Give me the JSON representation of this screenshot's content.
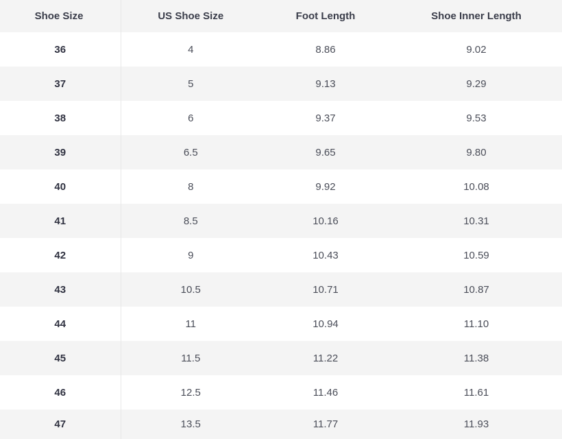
{
  "table": {
    "headers": [
      "Shoe Size",
      "US Shoe Size",
      "Foot Length",
      "Shoe Inner Length"
    ],
    "rows": [
      [
        "36",
        "4",
        "8.86",
        "9.02"
      ],
      [
        "37",
        "5",
        "9.13",
        "9.29"
      ],
      [
        "38",
        "6",
        "9.37",
        "9.53"
      ],
      [
        "39",
        "6.5",
        "9.65",
        "9.80"
      ],
      [
        "40",
        "8",
        "9.92",
        "10.08"
      ],
      [
        "41",
        "8.5",
        "10.16",
        "10.31"
      ],
      [
        "42",
        "9",
        "10.43",
        "10.59"
      ],
      [
        "43",
        "10.5",
        "10.71",
        "10.87"
      ],
      [
        "44",
        "11",
        "10.94",
        "11.10"
      ],
      [
        "45",
        "11.5",
        "11.22",
        "11.38"
      ],
      [
        "46",
        "12.5",
        "11.46",
        "11.61"
      ],
      [
        "47",
        "13.5",
        "11.77",
        "11.93"
      ]
    ]
  }
}
